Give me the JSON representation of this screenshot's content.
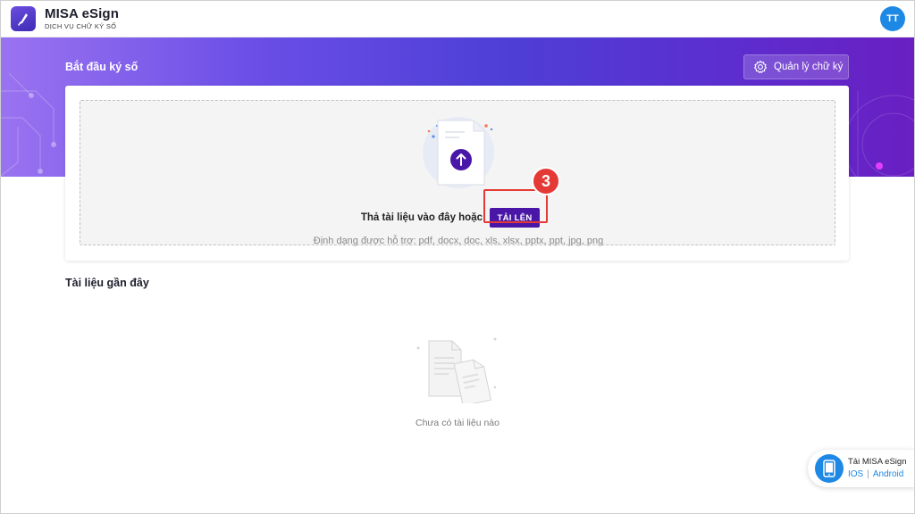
{
  "app": {
    "name": "MISA eSign",
    "subtitle": "DỊCH VỤ CHỮ KÝ SỐ",
    "user_initials": "TT"
  },
  "banner": {
    "title": "Bắt đầu ký số",
    "manage_button": "Quản lý chữ ký"
  },
  "upload": {
    "drop_text": "Thả tài liệu vào đây hoặc",
    "button_label": "TẢI LÊN",
    "formats_text": "Định dạng được hỗ trợ: pdf, docx, doc, xls, xlsx, pptx, ppt, jpg, png",
    "step_number": "3"
  },
  "recent": {
    "title": "Tài liệu gần đây",
    "empty_text": "Chưa có tài liệu nào"
  },
  "app_download": {
    "title": "Tải MISA eSign",
    "ios_label": "IOS",
    "separator": "|",
    "android_label": "Android"
  },
  "colors": {
    "accent": "#4a16a8",
    "banner_start": "#9a73f0",
    "banner_end": "#6a1fc2",
    "avatar": "#1e88e5",
    "highlight": "#e53935"
  },
  "icons": [
    "app-logo-icon",
    "settings-icon",
    "upload-arrow-icon",
    "document-icon",
    "empty-documents-icon",
    "phone-icon"
  ]
}
